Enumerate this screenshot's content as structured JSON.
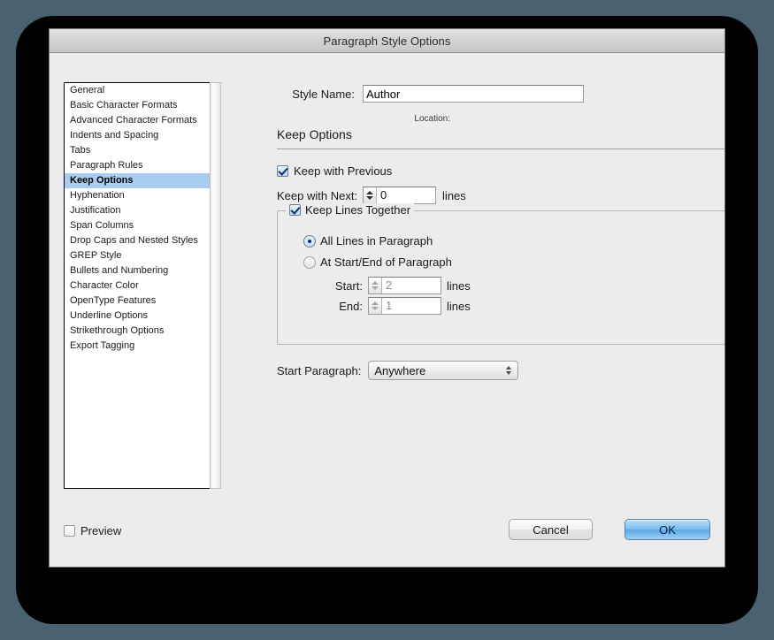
{
  "window": {
    "title": "Paragraph Style Options"
  },
  "sidebar": {
    "items": [
      {
        "label": "General",
        "selected": false
      },
      {
        "label": "Basic Character Formats",
        "selected": false
      },
      {
        "label": "Advanced Character Formats",
        "selected": false
      },
      {
        "label": "Indents and Spacing",
        "selected": false
      },
      {
        "label": "Tabs",
        "selected": false
      },
      {
        "label": "Paragraph Rules",
        "selected": false
      },
      {
        "label": "Keep Options",
        "selected": true
      },
      {
        "label": "Hyphenation",
        "selected": false
      },
      {
        "label": "Justification",
        "selected": false
      },
      {
        "label": "Span Columns",
        "selected": false
      },
      {
        "label": "Drop Caps and Nested Styles",
        "selected": false
      },
      {
        "label": "GREP Style",
        "selected": false
      },
      {
        "label": "Bullets and Numbering",
        "selected": false
      },
      {
        "label": "Character Color",
        "selected": false
      },
      {
        "label": "OpenType Features",
        "selected": false
      },
      {
        "label": "Underline Options",
        "selected": false
      },
      {
        "label": "Strikethrough Options",
        "selected": false
      },
      {
        "label": "Export Tagging",
        "selected": false
      }
    ]
  },
  "header": {
    "style_name_label": "Style Name:",
    "style_name_value": "Author",
    "location_label": "Location:"
  },
  "main": {
    "section_title": "Keep Options",
    "keep_with_previous": {
      "label": "Keep with Previous",
      "checked": true
    },
    "keep_with_next": {
      "label": "Keep with Next:",
      "value": "0",
      "unit": "lines"
    },
    "keep_lines_together": {
      "label": "Keep Lines Together",
      "checked": true,
      "options": [
        {
          "label": "All Lines in Paragraph",
          "selected": true
        },
        {
          "label": "At Start/End of Paragraph",
          "selected": false
        }
      ],
      "start": {
        "label": "Start:",
        "value": "2",
        "unit": "lines",
        "enabled": false
      },
      "end": {
        "label": "End:",
        "value": "1",
        "unit": "lines",
        "enabled": false
      }
    },
    "start_paragraph": {
      "label": "Start Paragraph:",
      "value": "Anywhere"
    }
  },
  "footer": {
    "preview_label": "Preview",
    "preview_checked": false,
    "cancel_label": "Cancel",
    "ok_label": "OK"
  },
  "colors": {
    "desktop": "#4a6170",
    "dialog_bg": "#ececec",
    "selection_blue": "#a9cdf0",
    "default_button_blue": "#7fbdee"
  }
}
